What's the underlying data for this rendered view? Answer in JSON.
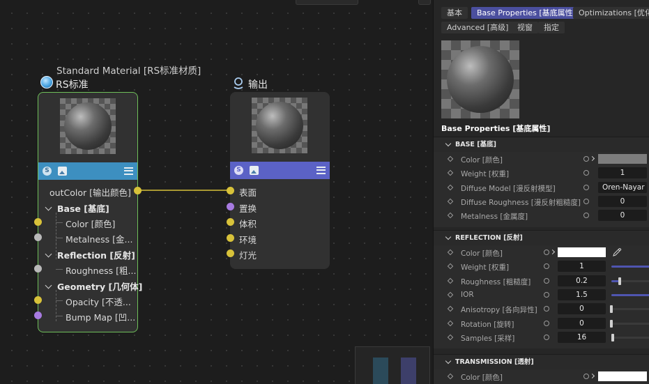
{
  "editor": {
    "standard_node": {
      "subtitle": "Standard Material [RS标准材质]",
      "title": "RS标准",
      "output_port": "outColor [输出颜色]",
      "rows": [
        {
          "label": "Base [基底]",
          "type": "group"
        },
        {
          "label": "Color [颜色]",
          "type": "port",
          "port": "yellow"
        },
        {
          "label": "Metalness [金...",
          "type": "port",
          "port": "grey"
        },
        {
          "label": "Reflection [反射]",
          "type": "group"
        },
        {
          "label": "Roughness [粗...",
          "type": "port",
          "port": "grey"
        },
        {
          "label": "Geometry [几何体]",
          "type": "group"
        },
        {
          "label": "Opacity [不透...",
          "type": "port",
          "port": "yellow"
        },
        {
          "label": "Bump Map [凹...",
          "type": "port",
          "port": "purple"
        }
      ],
      "bar_color": "#3d8fc0"
    },
    "output_node": {
      "title": "输出",
      "ports": [
        {
          "label": "表面",
          "port": "yellow"
        },
        {
          "label": "置换",
          "port": "purple"
        },
        {
          "label": "体积",
          "port": "yellow"
        },
        {
          "label": "环境",
          "port": "yellow"
        },
        {
          "label": "灯光",
          "port": "yellow"
        }
      ],
      "bar_color": "#5b62c6"
    },
    "colors": {
      "selection": "#6fbf5a",
      "wire": "#d8c23a"
    }
  },
  "panel": {
    "tabs_row1": [
      {
        "label": "基本",
        "active": false
      },
      {
        "label": "Base Properties [基底属性]",
        "active": true
      },
      {
        "label": "Optimizations [优化]",
        "active": false
      }
    ],
    "tabs_row2": [
      {
        "label": "Advanced [高级]",
        "active": false
      },
      {
        "label": "视窗",
        "active": false
      },
      {
        "label": "指定",
        "active": false
      }
    ],
    "preview_title": "Base Properties [基底属性]",
    "sections": [
      {
        "title": "BASE [基底]",
        "rows": [
          {
            "label": "Color [颜色]",
            "kind": "color",
            "color": "#7d7d7d"
          },
          {
            "label": "Weight [权重]",
            "kind": "number",
            "value": "1"
          },
          {
            "label": "Diffuse Model [漫反射模型]",
            "kind": "select",
            "value": "Oren-Nayar"
          },
          {
            "label": "Diffuse Roughness [漫反射粗糙度]",
            "kind": "number",
            "value": "0"
          },
          {
            "label": "Metalness [金属度]",
            "kind": "number",
            "value": "0"
          }
        ]
      },
      {
        "title": "REFLECTION [反射]",
        "rows": [
          {
            "label": "Color [颜色]",
            "kind": "color",
            "color": "#ffffff"
          },
          {
            "label": "Weight [权重]",
            "kind": "slider",
            "value": "1",
            "fraction": 1.0
          },
          {
            "label": "Roughness [粗糙度]",
            "kind": "slider",
            "value": "0.2",
            "fraction": 0.2
          },
          {
            "label": "IOR",
            "kind": "slider",
            "value": "1.5",
            "fraction": 1.0
          },
          {
            "label": "Anisotropy [各向异性]",
            "kind": "slider",
            "value": "0",
            "fraction": 0
          },
          {
            "label": "Rotation [旋转]",
            "kind": "slider",
            "value": "0",
            "fraction": 0
          },
          {
            "label": "Samples [采样]",
            "kind": "slider",
            "value": "16",
            "fraction": 0.03
          }
        ]
      },
      {
        "title": "TRANSMISSION [透射]",
        "rows": [
          {
            "label": "Color [颜色]",
            "kind": "color",
            "color": "#ffffff"
          }
        ]
      }
    ]
  }
}
